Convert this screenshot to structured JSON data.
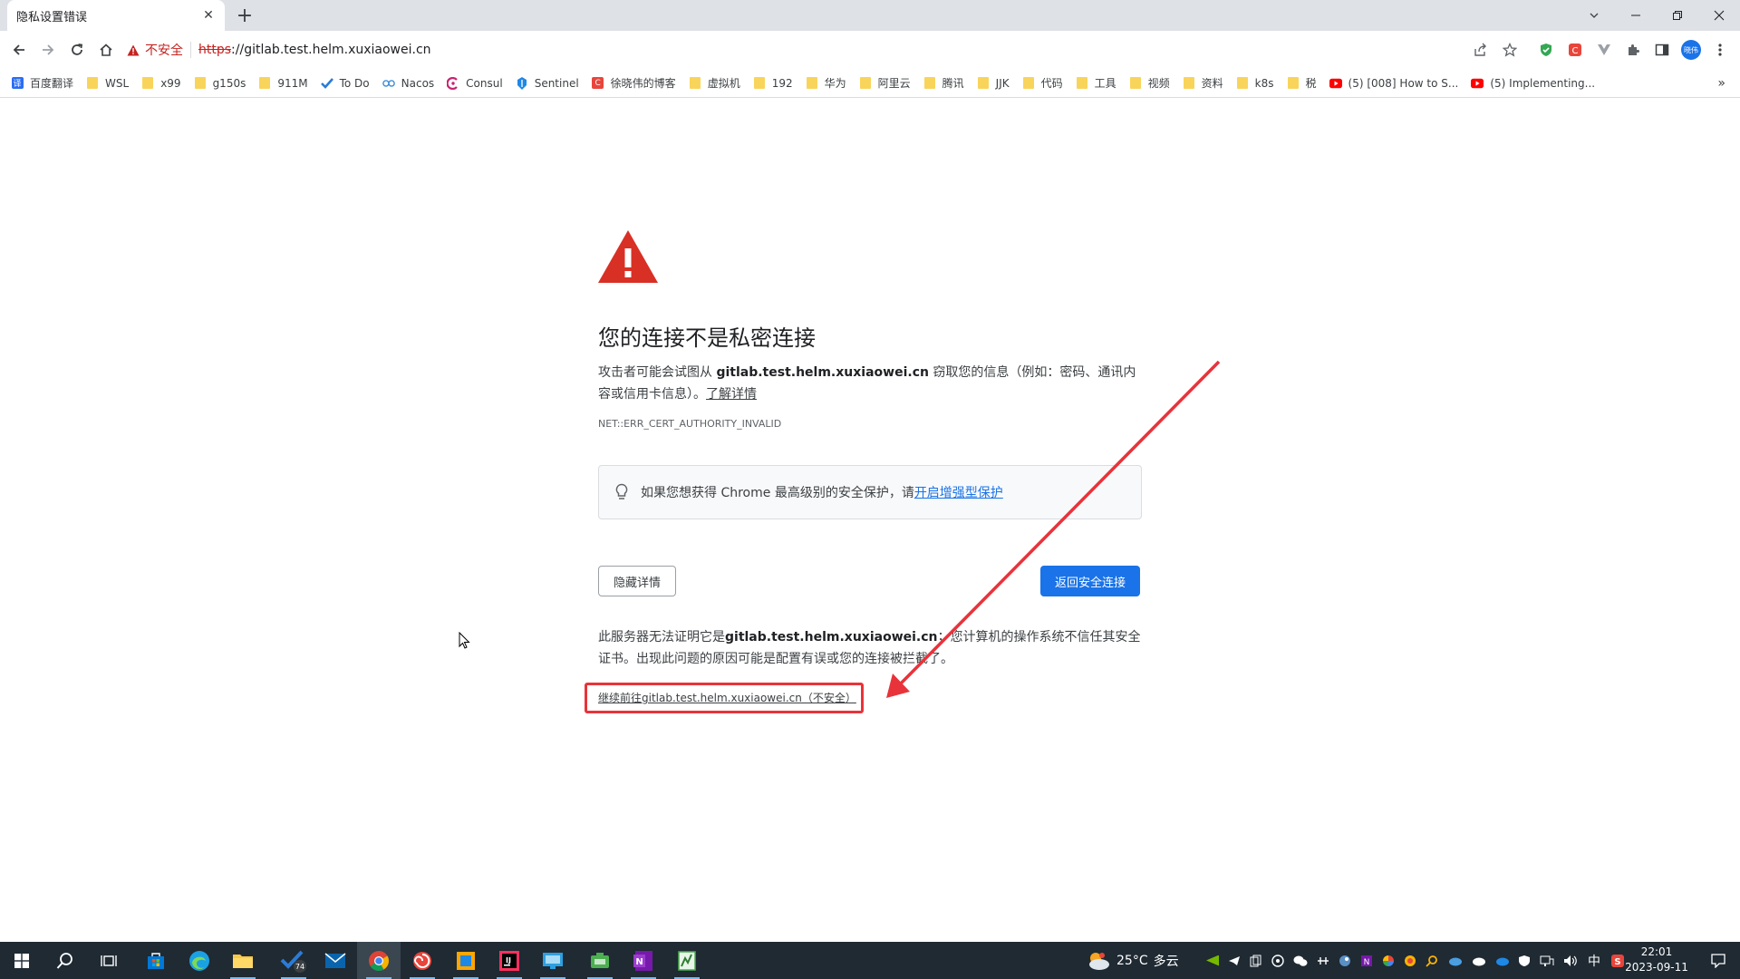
{
  "browser": {
    "tab_title": "隐私设置错误",
    "tab_close": "✕",
    "new_tab": "+",
    "security_label": "不安全",
    "url_scheme": "https",
    "url_rest": "://gitlab.test.helm.xuxiaowei.cn",
    "profile_avatar_text": "晓伟"
  },
  "bookmarks": [
    {
      "label": "百度翻译",
      "icon": "baidu-translate-icon"
    },
    {
      "label": "WSL",
      "icon": "folder-icon"
    },
    {
      "label": "x99",
      "icon": "folder-icon"
    },
    {
      "label": "g150s",
      "icon": "folder-icon"
    },
    {
      "label": "911M",
      "icon": "folder-icon"
    },
    {
      "label": "To Do",
      "icon": "todo-check-icon"
    },
    {
      "label": "Nacos",
      "icon": "nacos-icon"
    },
    {
      "label": "Consul",
      "icon": "consul-icon"
    },
    {
      "label": "Sentinel",
      "icon": "sentinel-icon"
    },
    {
      "label": "徐晓伟的博客",
      "icon": "blog-icon"
    },
    {
      "label": "虚拟机",
      "icon": "folder-icon"
    },
    {
      "label": "192",
      "icon": "folder-icon"
    },
    {
      "label": "华为",
      "icon": "folder-icon"
    },
    {
      "label": "阿里云",
      "icon": "folder-icon"
    },
    {
      "label": "腾讯",
      "icon": "folder-icon"
    },
    {
      "label": "JJK",
      "icon": "folder-icon"
    },
    {
      "label": "代码",
      "icon": "folder-icon"
    },
    {
      "label": "工具",
      "icon": "folder-icon"
    },
    {
      "label": "视频",
      "icon": "folder-icon"
    },
    {
      "label": "资料",
      "icon": "folder-icon"
    },
    {
      "label": "k8s",
      "icon": "folder-icon"
    },
    {
      "label": "税",
      "icon": "folder-icon"
    },
    {
      "label": "(5) [008] How to S...",
      "icon": "youtube-icon"
    },
    {
      "label": "(5) Implementing...",
      "icon": "youtube-icon"
    }
  ],
  "bookmarks_more": "»",
  "page": {
    "headline": "您的连接不是私密连接",
    "desc_prefix": "攻击者可能会试图从 ",
    "desc_host": "gitlab.test.helm.xuxiaowei.cn",
    "desc_suffix": " 窃取您的信息（例如：密码、通讯内容或信用卡信息）。",
    "learn_more": "了解详情",
    "error_code": "NET::ERR_CERT_AUTHORITY_INVALID",
    "promo_text": "如果您想获得 Chrome 最高级别的安全保护，请",
    "promo_link": "开启增强型保护",
    "hide_details": "隐藏详情",
    "back_to_safety": "返回安全连接",
    "details_prefix": "此服务器无法证明它是",
    "details_host": "gitlab.test.helm.xuxiaowei.cn",
    "details_suffix": "；您计算机的操作系统不信任其安全证书。出现此问题的原因可能是配置有误或您的连接被拦截了。",
    "proceed_link": "继续前往gitlab.test.helm.xuxiaowei.cn（不安全）"
  },
  "annotation": {
    "highlight_color": "#e8333a"
  },
  "taskbar": {
    "weather_temp": "25°C",
    "weather_desc": "多云",
    "ime": "中",
    "time": "22:01",
    "date": "2023-09-11",
    "badge_count": "74"
  },
  "colors": {
    "accent": "#1a73e8",
    "danger": "#c5221f",
    "warning_icon": "#d93025"
  }
}
